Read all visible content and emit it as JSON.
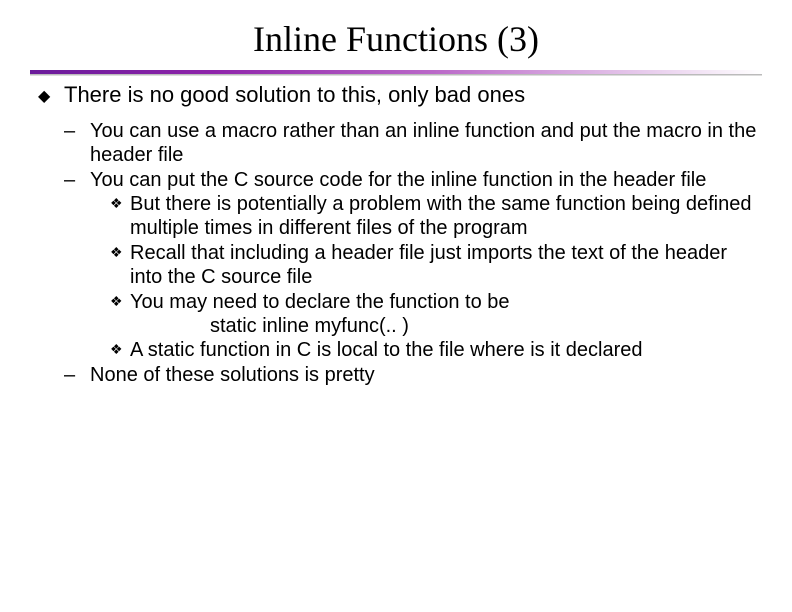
{
  "title": "Inline Functions (3)",
  "main_point": "There is no good solution to this, only bad ones",
  "sub": {
    "a": "You can use a macro rather than an inline function and put the macro in the header file",
    "b": "You can put the C source code for the inline function in the header file",
    "b1": "But there is potentially a problem with the same function being defined multiple times in different files of the program",
    "b2": "Recall that including a header file just imports the text of the header into the C source file",
    "b3": "You may need to declare the function to be",
    "b3_code": "static inline myfunc(.. )",
    "b4": "A static function in C is local to the file where is it declared",
    "c": "None of these solutions is pretty"
  }
}
